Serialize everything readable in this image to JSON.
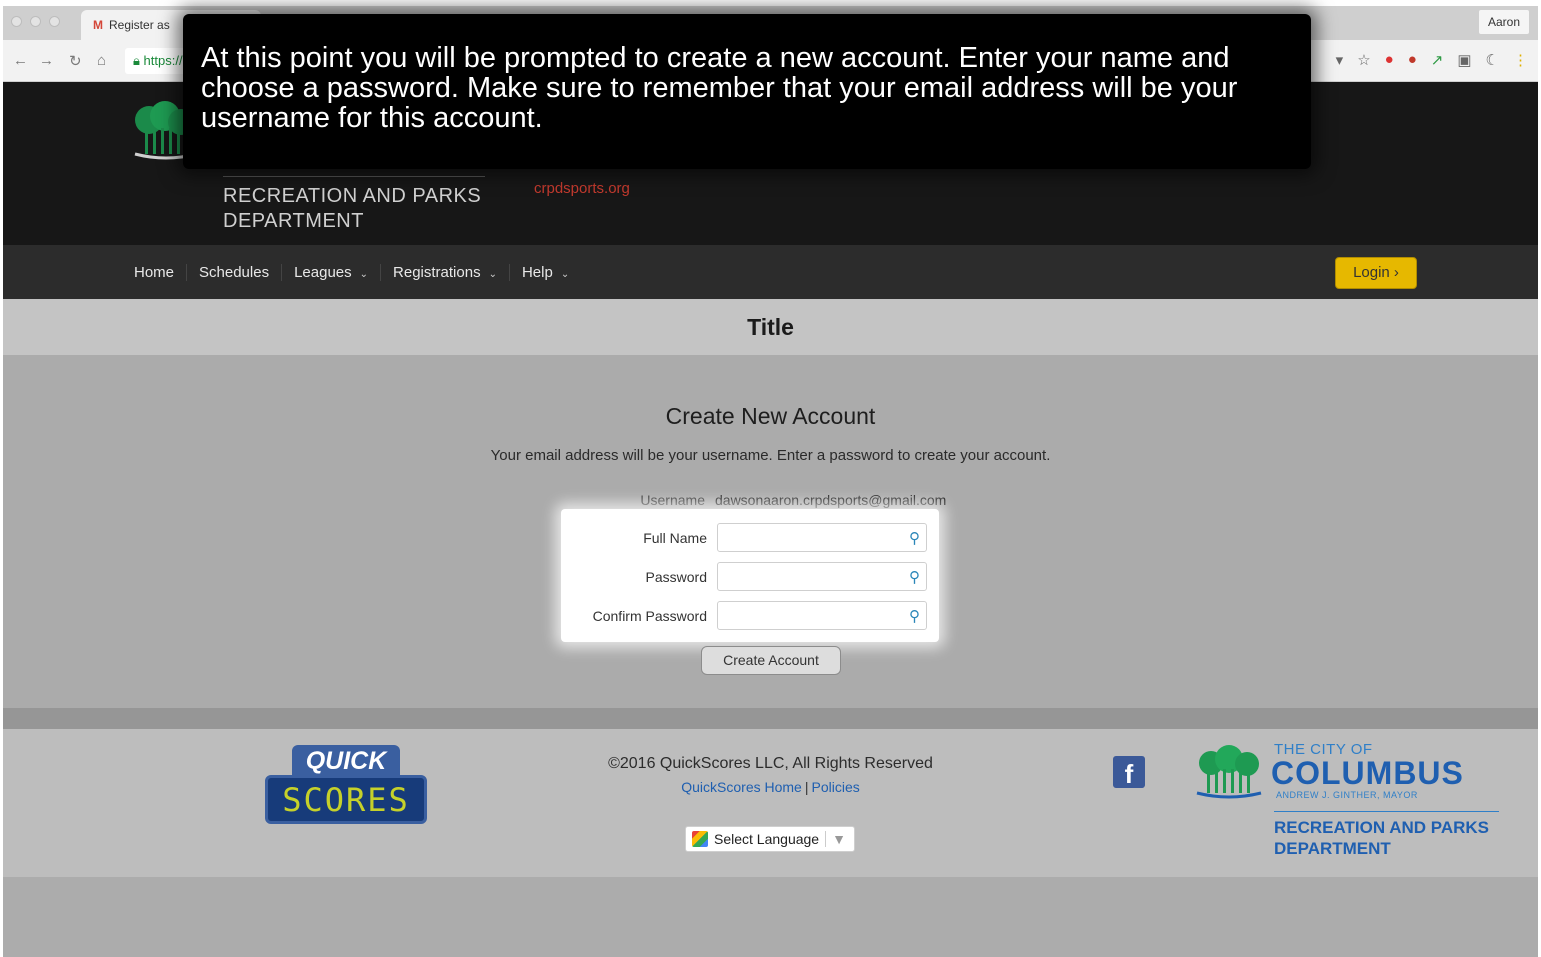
{
  "browser": {
    "tab_title": "Register as",
    "gmail_glyph": "M",
    "profile_name": "Aaron",
    "url_partial": "https://",
    "icons": [
      "back-icon",
      "forward-icon",
      "reload-icon",
      "home-icon",
      "lock-icon",
      "star-icon",
      "adblock-icon",
      "flag-icon",
      "extension-icon",
      "extension-icon",
      "moon-icon",
      "menu-icon"
    ]
  },
  "overlay": {
    "caption": "At this point you will be prompted to create a new account. Enter your name and choose a password. Make sure to remember that your email address will be your username for this account."
  },
  "site": {
    "dept_line1": "RECREATION AND PARKS",
    "dept_line2": "DEPARTMENT",
    "site_link": "crpdsports.org",
    "brand_color": "#171717",
    "accent_color": "#e6b800"
  },
  "nav": {
    "home": "Home",
    "schedules": "Schedules",
    "leagues": "Leagues",
    "registrations": "Registrations",
    "help": "Help",
    "caret": "⌄",
    "login": "Login ›"
  },
  "page": {
    "title": "Title"
  },
  "form": {
    "heading": "Create New Account",
    "intro": "Your email address will be your username.  Enter a password to create your account.",
    "username_label": "Username",
    "username_value": "dawsonaaron.crpdsports@gmail.com",
    "fields": [
      {
        "label": "Full Name",
        "value": ""
      },
      {
        "label": "Password",
        "value": ""
      },
      {
        "label": "Confirm Password",
        "value": ""
      }
    ],
    "field_icon": "key-icon",
    "submit_label": "Create Account"
  },
  "footer": {
    "qs_top": "QUICK",
    "qs_bottom": "SCORES",
    "copyright": "©2016 QuickScores LLC, All Rights Reserved",
    "link_home": "QuickScores Home",
    "link_sep": "|",
    "link_policies": "Policies",
    "language_label": "Select Language",
    "language_caret": "▼",
    "fb_glyph": "f",
    "city_small": "THE CITY OF",
    "city_big": "COLUMBUS",
    "city_mayor": "ANDREW J. GINTHER, MAYOR",
    "city_dept1": "RECREATION AND PARKS",
    "city_dept2": "DEPARTMENT"
  }
}
